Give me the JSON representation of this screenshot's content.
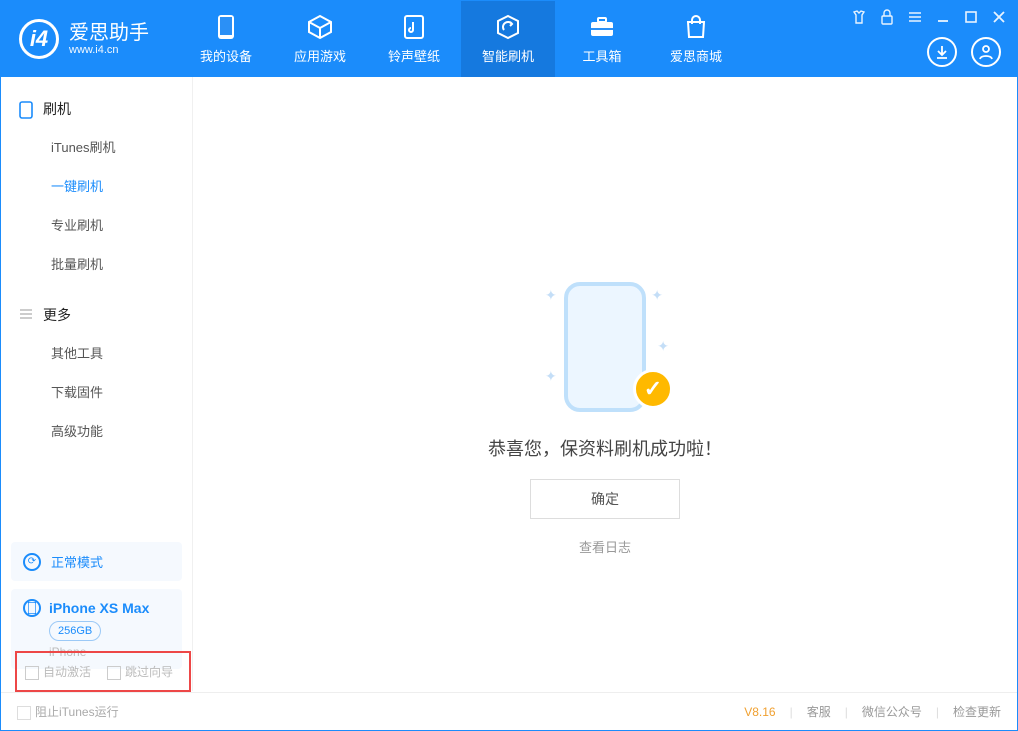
{
  "app": {
    "name": "爱思助手",
    "site": "www.i4.cn"
  },
  "header_tabs": {
    "device": "我的设备",
    "apps": "应用游戏",
    "ring": "铃声壁纸",
    "flash": "智能刷机",
    "tool": "工具箱",
    "store": "爱思商城"
  },
  "sidebar": {
    "flash_section": "刷机",
    "items": {
      "itunes": "iTunes刷机",
      "oneclick": "一键刷机",
      "pro": "专业刷机",
      "batch": "批量刷机"
    },
    "more_section": "更多",
    "more": {
      "other": "其他工具",
      "fw": "下载固件",
      "adv": "高级功能"
    }
  },
  "mode_card": {
    "label": "正常模式"
  },
  "device": {
    "name": "iPhone XS Max",
    "storage": "256GB",
    "type": "iPhone"
  },
  "options": {
    "auto_activate": "自动激活",
    "skip_wizard": "跳过向导"
  },
  "main": {
    "message": "恭喜您，保资料刷机成功啦！",
    "ok": "确定",
    "log": "查看日志"
  },
  "status": {
    "block_itunes": "阻止iTunes运行",
    "version": "V8.16",
    "support": "客服",
    "wechat": "微信公众号",
    "update": "检查更新"
  }
}
